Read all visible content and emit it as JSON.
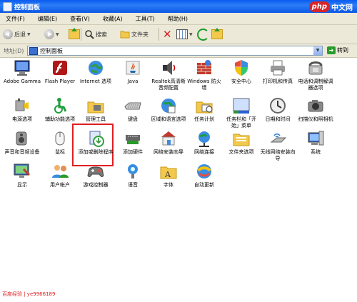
{
  "window": {
    "title": "控制面板"
  },
  "brand": {
    "php": "php",
    "cn": "中文网"
  },
  "menu": [
    "文件(F)",
    "编辑(E)",
    "查看(V)",
    "收藏(A)",
    "工具(T)",
    "帮助(H)"
  ],
  "toolbar": {
    "back": "后退",
    "search": "搜索",
    "folders": "文件夹"
  },
  "address": {
    "label": "地址(D)",
    "value": "控制面板",
    "go": "转到"
  },
  "items": [
    {
      "label": "Adobe Gamma",
      "icon": "monitor-icon"
    },
    {
      "label": "Flash Player",
      "icon": "flash-icon"
    },
    {
      "label": "Internet 选项",
      "icon": "globe-icon"
    },
    {
      "label": "Java",
      "icon": "java-icon"
    },
    {
      "label": "Realtek高清晰音频配置",
      "icon": "speaker-icon"
    },
    {
      "label": "Windows 防火墙",
      "icon": "firewall-icon"
    },
    {
      "label": "安全中心",
      "icon": "shield-icon"
    },
    {
      "label": "打印机和传真",
      "icon": "printer-icon"
    },
    {
      "label": "电话和调制解调器选项",
      "icon": "phone-icon"
    },
    {
      "label": "电源选项",
      "icon": "power-icon"
    },
    {
      "label": "辅助功能选项",
      "icon": "accessibility-icon"
    },
    {
      "label": "管理工具",
      "icon": "admin-tools-icon"
    },
    {
      "label": "键盘",
      "icon": "keyboard-icon"
    },
    {
      "label": "区域和语言选项",
      "icon": "region-icon"
    },
    {
      "label": "任务计划",
      "icon": "scheduled-tasks-icon"
    },
    {
      "label": "任务栏和「开始」菜单",
      "icon": "taskbar-icon"
    },
    {
      "label": "日期和时间",
      "icon": "clock-icon"
    },
    {
      "label": "扫描仪和照相机",
      "icon": "camera-icon"
    },
    {
      "label": "声音和音频设备",
      "icon": "sound-icon"
    },
    {
      "label": "鼠标",
      "icon": "mouse-icon"
    },
    {
      "label": "添加或删除程序",
      "icon": "add-remove-icon"
    },
    {
      "label": "添加硬件",
      "icon": "add-hardware-icon"
    },
    {
      "label": "网络安装向导",
      "icon": "network-wizard-icon"
    },
    {
      "label": "网络连接",
      "icon": "network-icon"
    },
    {
      "label": "文件夹选项",
      "icon": "folder-options-icon"
    },
    {
      "label": "无线网络安装向导",
      "icon": "wireless-icon"
    },
    {
      "label": "系统",
      "icon": "system-icon"
    },
    {
      "label": "显示",
      "icon": "display-icon"
    },
    {
      "label": "用户帐户",
      "icon": "users-icon"
    },
    {
      "label": "游戏控制器",
      "icon": "gamepad-icon"
    },
    {
      "label": "语音",
      "icon": "speech-icon"
    },
    {
      "label": "字体",
      "icon": "fonts-icon"
    },
    {
      "label": "自动更新",
      "icon": "update-icon"
    }
  ],
  "highlighted_item": "添加或删除程序",
  "footer": "百度经验 | ye9966189",
  "colors": {
    "title_bar": "#0a5cf0",
    "highlight": "#e02020",
    "chrome": "#ece9d8"
  }
}
